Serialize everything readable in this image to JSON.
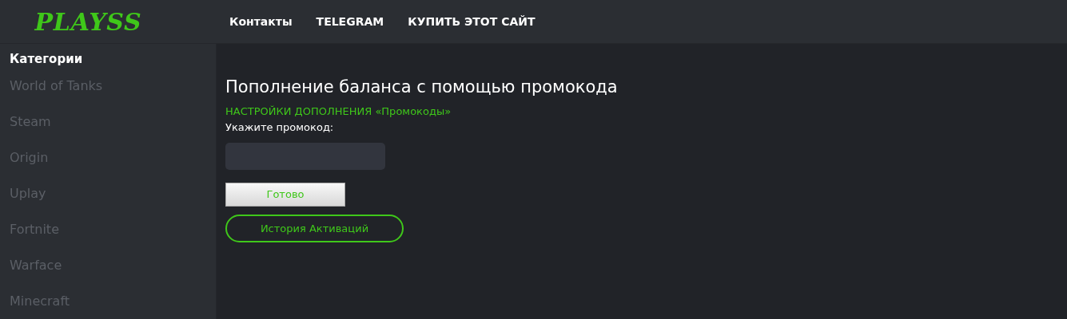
{
  "header": {
    "logo": "PLAYSS",
    "nav": [
      "Контакты",
      "TELEGRAM",
      "КУПИТЬ ЭТОТ САЙТ"
    ]
  },
  "sidebar": {
    "title": "Категории",
    "items": [
      "World of Tanks",
      "Steam",
      "Origin",
      "Uplay",
      "Fortnite",
      "Warface",
      "Minecraft"
    ]
  },
  "main": {
    "title": "Пополнение баланса с помощью промокода",
    "subtitle": "НАСТРОЙКИ ДОПОЛНЕНИЯ «Промокоды»",
    "field_label": "Укажите промокод:",
    "submit_button": "Готово",
    "history_button": "История Активаций"
  }
}
